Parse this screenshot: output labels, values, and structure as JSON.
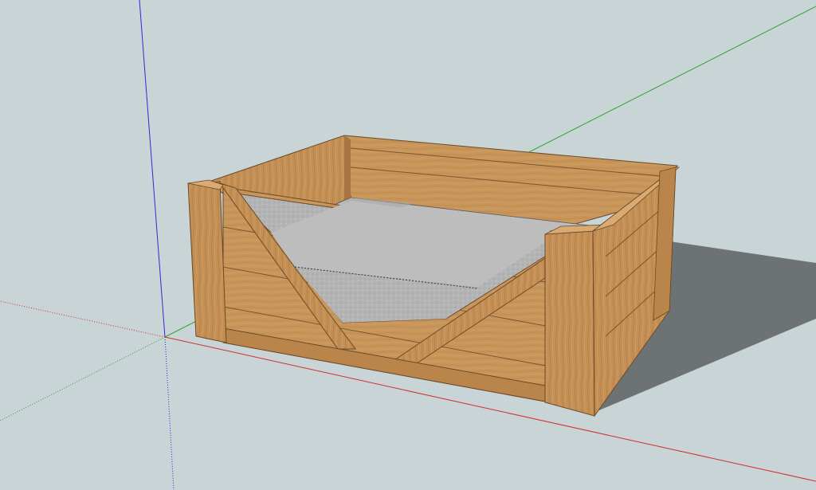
{
  "app": {
    "kind": "3D modeling viewport",
    "background_color": "#c8d4d6"
  },
  "axes": {
    "x_axis_color": "#d23030",
    "y_axis_color": "#2fa32f",
    "z_axis_color": "#2b2bd8",
    "negative_axes_dotted": true
  },
  "model": {
    "name_visible": false,
    "description_visible": false,
    "wood_color": "#c8955a",
    "wood_dark": "#a87640",
    "wood_light": "#d9ab72",
    "cushion_color": "#aeaeae",
    "shadow_color": "#6d7374"
  }
}
